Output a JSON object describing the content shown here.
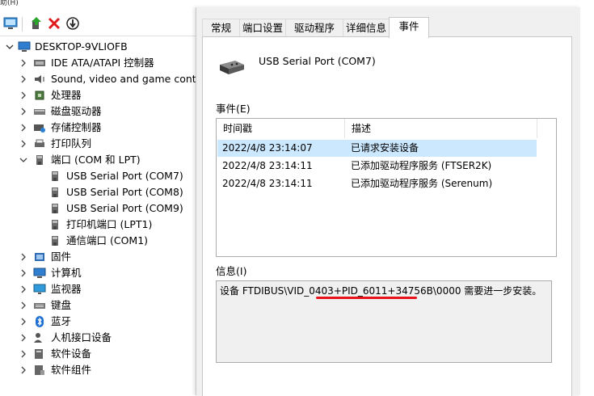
{
  "device_manager": {
    "title_fragment": "助(H)",
    "computer_name": "DESKTOP-9VLIOFB",
    "tree": [
      {
        "label": "IDE ATA/ATAPI 控制器",
        "icon": "ide-controller-icon",
        "expanded": false
      },
      {
        "label": "Sound, video and game controllers",
        "icon": "sound-icon",
        "expanded": false
      },
      {
        "label": "处理器",
        "icon": "processor-icon",
        "expanded": false
      },
      {
        "label": "磁盘驱动器",
        "icon": "disk-drive-icon",
        "expanded": false
      },
      {
        "label": "存储控制器",
        "icon": "storage-controller-icon",
        "expanded": false
      },
      {
        "label": "打印队列",
        "icon": "print-queue-icon",
        "expanded": false
      },
      {
        "label": "端口 (COM 和 LPT)",
        "icon": "port-icon",
        "expanded": true,
        "children": [
          {
            "label": "USB Serial Port (COM7)",
            "icon": "port-icon"
          },
          {
            "label": "USB Serial Port (COM8)",
            "icon": "port-icon"
          },
          {
            "label": "USB Serial Port (COM9)",
            "icon": "port-icon"
          },
          {
            "label": "打印机端口 (LPT1)",
            "icon": "port-icon"
          },
          {
            "label": "通信端口 (COM1)",
            "icon": "port-icon"
          }
        ]
      },
      {
        "label": "固件",
        "icon": "firmware-icon",
        "expanded": false
      },
      {
        "label": "计算机",
        "icon": "computer-icon",
        "expanded": false
      },
      {
        "label": "监视器",
        "icon": "monitor-icon",
        "expanded": false
      },
      {
        "label": "键盘",
        "icon": "keyboard-icon",
        "expanded": false
      },
      {
        "label": "蓝牙",
        "icon": "bluetooth-icon",
        "expanded": false
      },
      {
        "label": "人机接口设备",
        "icon": "hid-icon",
        "expanded": false
      },
      {
        "label": "软件设备",
        "icon": "software-device-icon",
        "expanded": false
      },
      {
        "label": "软件组件",
        "icon": "software-component-icon",
        "expanded": false
      }
    ],
    "toolbar_icons": [
      "scan-hardware-icon",
      "update-driver-icon",
      "uninstall-icon",
      "disable-icon"
    ]
  },
  "dialog": {
    "tabs": [
      "常规",
      "端口设置",
      "驱动程序",
      "详细信息",
      "事件"
    ],
    "active_tab": 4,
    "device_name": "USB Serial Port (COM7)",
    "events_label": "事件(E)",
    "columns": {
      "time": "时间戳",
      "desc": "描述"
    },
    "events": [
      {
        "time": "2022/4/8 23:14:07",
        "desc": "已请求安装设备",
        "selected": true
      },
      {
        "time": "2022/4/8 23:14:11",
        "desc": "已添加驱动程序服务 (FTSER2K)",
        "selected": false
      },
      {
        "time": "2022/4/8 23:14:11",
        "desc": "已添加驱动程序服务 (Serenum)",
        "selected": false
      }
    ],
    "info_label": "信息(I)",
    "info_text": "设备 FTDIBUS\\VID_0403+PID_6011+34756B\\0000 需要进一步安装。"
  },
  "colors": {
    "selection": "#cce8ff",
    "annotation": "#e8121b",
    "dialog_bg": "#f0f0f0"
  }
}
